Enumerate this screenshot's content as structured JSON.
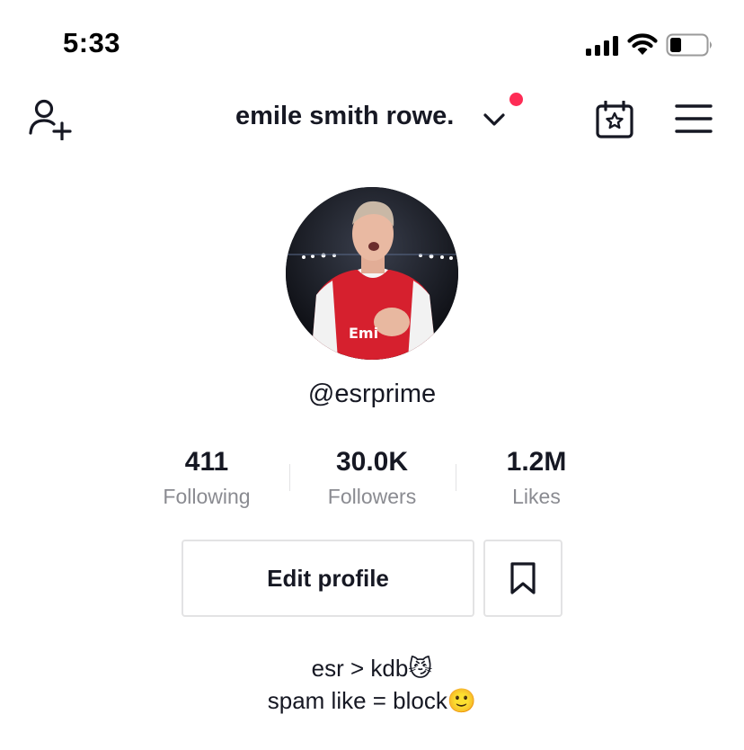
{
  "status_bar": {
    "time": "5:33",
    "icons": [
      "signal-icon",
      "wifi-icon",
      "battery-icon"
    ]
  },
  "nav": {
    "add_friend_icon": "add-user-icon",
    "username": "emile smith rowe.",
    "switch_account_icon": "chevron-down-icon",
    "notification_dot_color": "#fe2c55",
    "calendar_icon": "calendar-star-icon",
    "menu_icon": "hamburger-menu-icon"
  },
  "profile": {
    "handle": "@esrprime",
    "stats": [
      {
        "value": "411",
        "label": "Following"
      },
      {
        "value": "30.0K",
        "label": "Followers"
      },
      {
        "value": "1.2M",
        "label": "Likes"
      }
    ],
    "edit_button_label": "Edit profile",
    "bookmark_icon": "bookmark-icon",
    "bio": [
      "esr > kdb😼",
      "spam like = block🙂"
    ]
  },
  "colors": {
    "text_primary": "#161823",
    "text_secondary": "#8a8b91",
    "border": "#e3e3e4",
    "accent_red": "#fe2c55",
    "jersey_red": "#d6202e"
  }
}
